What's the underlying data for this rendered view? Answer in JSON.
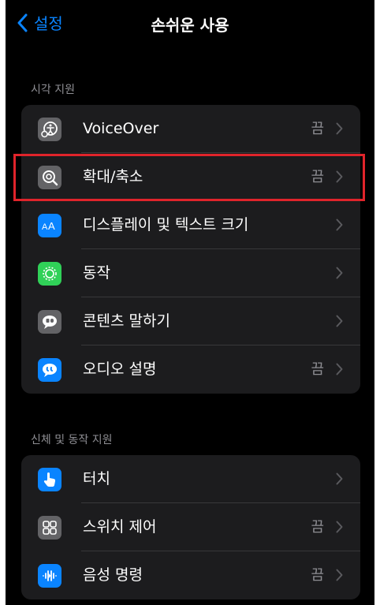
{
  "nav": {
    "back_label": "설정",
    "title": "손쉬운 사용"
  },
  "sections": [
    {
      "header": "시각 지원",
      "items": [
        {
          "label": "VoiceOver",
          "value": "끔",
          "icon": "voiceover-icon",
          "icon_color": "#636366"
        },
        {
          "label": "확대/축소",
          "value": "끔",
          "icon": "zoom-icon",
          "icon_color": "#636366"
        },
        {
          "label": "디스플레이 및 텍스트 크기",
          "value": "",
          "icon": "text-size-icon",
          "icon_color": "#0a84ff"
        },
        {
          "label": "동작",
          "value": "",
          "icon": "motion-icon",
          "icon_color": "#30d158"
        },
        {
          "label": "콘텐츠 말하기",
          "value": "",
          "icon": "speech-bubble-icon",
          "icon_color": "#636366"
        },
        {
          "label": "오디오 설명",
          "value": "끔",
          "icon": "audio-description-icon",
          "icon_color": "#0a84ff"
        }
      ]
    },
    {
      "header": "신체 및 동작 지원",
      "items": [
        {
          "label": "터치",
          "value": "",
          "icon": "touch-hand-icon",
          "icon_color": "#0a84ff"
        },
        {
          "label": "스위치 제어",
          "value": "끔",
          "icon": "switch-control-icon",
          "icon_color": "#636366"
        },
        {
          "label": "음성 명령",
          "value": "끔",
          "icon": "voice-control-icon",
          "icon_color": "#0a84ff"
        }
      ]
    }
  ]
}
